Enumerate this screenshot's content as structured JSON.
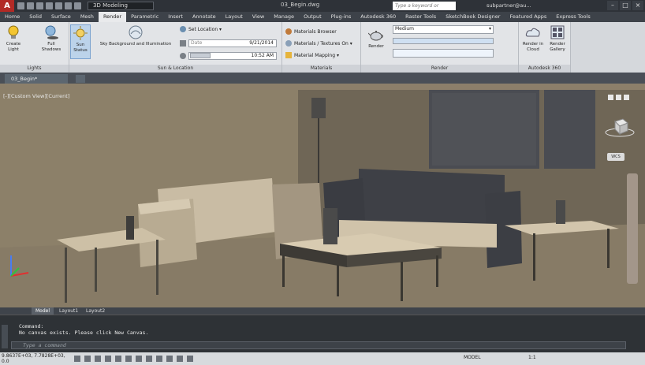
{
  "titlebar": {
    "app_letter": "A",
    "workspace": "3D Modeling",
    "document_title": "03_Begin.dwg",
    "search_placeholder": "Type a keyword or phrase",
    "user": "subpartner@au..."
  },
  "ribbon_tabs": [
    "Home",
    "Solid",
    "Surface",
    "Mesh",
    "Render",
    "Parametric",
    "Insert",
    "Annotate",
    "Layout",
    "View",
    "Manage",
    "Output",
    "Plug-ins",
    "Autodesk 360",
    "Raster Tools",
    "SketchBook Designer",
    "Featured Apps",
    "Express Tools"
  ],
  "active_tab": "Render",
  "ribbon": {
    "lights": {
      "title": "Lights",
      "create_light": "Create Light",
      "full_shadows": "Full Shadows"
    },
    "sun": {
      "title": "Sun & Location",
      "sun_status": "Sun Status",
      "sky_bg": "Sky Background and Illumination",
      "set_location": "Set Location",
      "date_label": "Date",
      "date_value": "9/21/2014",
      "time_value": "10:52 AM"
    },
    "materials": {
      "title": "Materials",
      "browser": "Materials Browser",
      "textures": "Materials / Textures On",
      "mapping": "Material Mapping"
    },
    "render": {
      "title": "Render",
      "render_label": "Render",
      "preset": "Medium"
    },
    "a360": {
      "title": "Autodesk 360",
      "cloud": "Render in Cloud",
      "gallery": "Render Gallery"
    }
  },
  "document_tab": "03_Begin*",
  "viewport": {
    "label": "[-][Custom View][Current]",
    "wcs": "WCS"
  },
  "layout_tabs": [
    "Model",
    "Layout1",
    "Layout2"
  ],
  "command": {
    "history": [
      "Command:",
      "No canvas exists. Please click New Canvas."
    ],
    "placeholder": "Type a command"
  },
  "statusbar": {
    "coords": "9.8637E+03, 7.7828E+03, 0.0",
    "model": "MODEL",
    "scale": "1:1"
  },
  "colors": {
    "accent": "#b22a25",
    "ribbon": "#e2e4e7",
    "viewport_bg": "#8c7f6a"
  }
}
